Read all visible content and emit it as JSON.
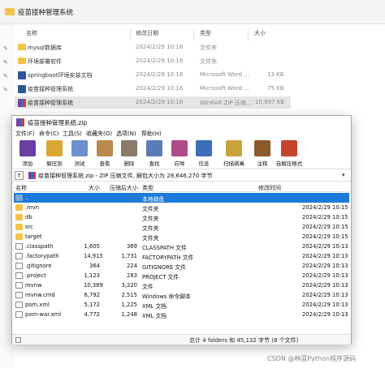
{
  "explorer": {
    "title": "疫苗接种管理系统",
    "headers": {
      "name": "名称",
      "modified": "修改日期",
      "type": "类型",
      "size": "大小"
    },
    "rows": [
      {
        "name": "mysql数据库",
        "date": "2024/2/29 10:16",
        "type": "文件夹",
        "size": "",
        "icon": "folder-icon"
      },
      {
        "name": "环境部署软件",
        "date": "2024/2/29 10:16",
        "type": "文件夹",
        "size": "",
        "icon": "folder-icon"
      },
      {
        "name": "springboot环境安装文档",
        "date": "2024/2/29 10:16",
        "type": "Microsoft Word ...",
        "size": "13 KB",
        "icon": "word-icon"
      },
      {
        "name": "疫苗接种管理系统",
        "date": "2024/2/29 10:16",
        "type": "Microsoft Word ...",
        "size": "75 KB",
        "icon": "word-icon"
      },
      {
        "name": "疫苗接种管理系统",
        "date": "2024/2/29 10:16",
        "type": "WinRAR ZIP 压缩...",
        "size": "10,997 KB",
        "icon": "winrar-icon"
      }
    ]
  },
  "rar": {
    "title": "疫苗接种管理系统.zip",
    "menu": [
      "文件(F)",
      "命令(C)",
      "工具(S)",
      "收藏夹(O)",
      "选项(N)",
      "帮助(H)"
    ],
    "toolbar": [
      {
        "label": "添加",
        "icon": "add-icon",
        "color": "#6a3fa0"
      },
      {
        "label": "解压到",
        "icon": "extract-to-icon",
        "color": "#d9a733"
      },
      {
        "label": "测试",
        "icon": "test-icon",
        "color": "#6b8fcf"
      },
      {
        "label": "查看",
        "icon": "view-icon",
        "color": "#b98a4c"
      },
      {
        "label": "删除",
        "icon": "delete-icon",
        "color": "#8a7a6a"
      },
      {
        "label": "查找",
        "icon": "find-icon",
        "color": "#5a7bb8"
      },
      {
        "label": "向导",
        "icon": "wizard-icon",
        "color": "#b04b8a"
      },
      {
        "label": "信息",
        "icon": "info-icon",
        "color": "#3c6fb5"
      },
      {
        "label": "扫描病毒",
        "icon": "scan-virus-icon",
        "color": "#c9a23c"
      },
      {
        "label": "注释",
        "icon": "comment-icon",
        "color": "#8b5a2b"
      },
      {
        "label": "自解压格式",
        "icon": "sfx-icon",
        "color": "#c6432d"
      }
    ],
    "address": "疫苗接种管理系统.zip - ZIP 压缩文件, 解包大小为 28,646,270 字节",
    "headers": {
      "name": "名称",
      "size": "大小",
      "packed": "压缩后大小",
      "type": "类型",
      "modified": "修改时间"
    },
    "rows": [
      {
        "name": "..",
        "size": "",
        "packed": "",
        "type": "本地磁盘",
        "modified": "",
        "icon": "up-folder-icon",
        "selected": true
      },
      {
        "name": ".mvn",
        "size": "",
        "packed": "",
        "type": "文件夹",
        "modified": "2024/2/29 10:15",
        "icon": "folder-icon"
      },
      {
        "name": "db",
        "size": "",
        "packed": "",
        "type": "文件夹",
        "modified": "2024/2/29 10:15",
        "icon": "folder-icon"
      },
      {
        "name": "src",
        "size": "",
        "packed": "",
        "type": "文件夹",
        "modified": "2024/2/29 10:15",
        "icon": "folder-icon"
      },
      {
        "name": "target",
        "size": "",
        "packed": "",
        "type": "文件夹",
        "modified": "2024/2/29 10:15",
        "icon": "folder-icon"
      },
      {
        "name": ".classpath",
        "size": "1,605",
        "packed": "369",
        "type": "CLASSPATH 文件",
        "modified": "2024/2/29 10:13",
        "icon": "file-icon"
      },
      {
        "name": ".factorypath",
        "size": "14,915",
        "packed": "1,731",
        "type": "FACTORYPATH 文件",
        "modified": "2024/2/29 10:13",
        "icon": "file-icon"
      },
      {
        "name": ".gitignore",
        "size": "364",
        "packed": "224",
        "type": "GITIGNORE 文件",
        "modified": "2024/2/29 10:13",
        "icon": "file-icon"
      },
      {
        "name": ".project",
        "size": "1,123",
        "packed": "283",
        "type": "PROJECT 文件",
        "modified": "2024/2/29 10:13",
        "icon": "file-icon"
      },
      {
        "name": "mvnw",
        "size": "10,389",
        "packed": "3,220",
        "type": "文件",
        "modified": "2024/2/29 10:13",
        "icon": "file-icon"
      },
      {
        "name": "mvnw.cmd",
        "size": "6,792",
        "packed": "2,515",
        "type": "Windows 命令脚本",
        "modified": "2024/2/29 10:13",
        "icon": "file-icon"
      },
      {
        "name": "pom.xml",
        "size": "5,172",
        "packed": "1,225",
        "type": "XML 文档",
        "modified": "2024/2/29 10:13",
        "icon": "file-icon"
      },
      {
        "name": "pom-war.xml",
        "size": "4,772",
        "packed": "1,248",
        "type": "XML 文档",
        "modified": "2024/2/29 10:13",
        "icon": "file-icon"
      }
    ],
    "status": "总计 4 folders 和 45,132 字节 (8 个文件)"
  },
  "watermark": "CSDN @林蓝Python程序源码"
}
